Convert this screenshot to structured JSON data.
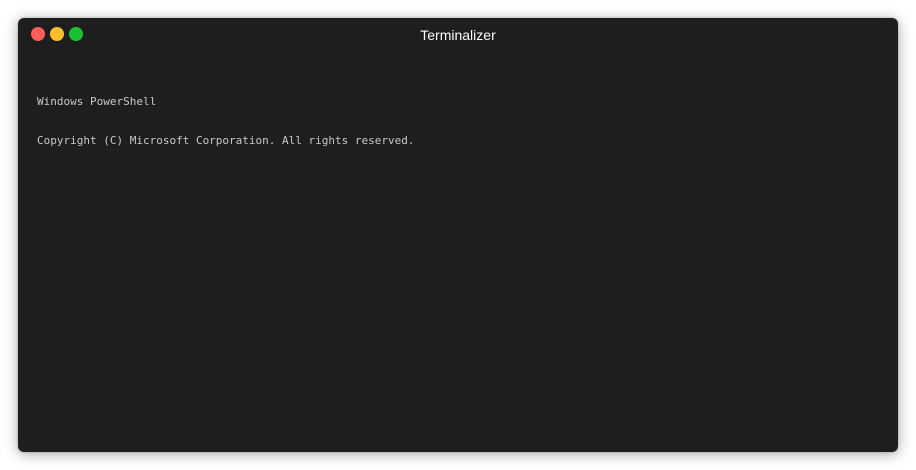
{
  "window": {
    "title": "Terminalizer"
  },
  "colors": {
    "background": "#1e1e1e",
    "close": "#ff5f58",
    "minimize": "#ffbd2e",
    "zoom": "#18c132",
    "text": "#c8c8c8"
  },
  "terminal": {
    "lines": [
      "Windows PowerShell",
      "Copyright (C) Microsoft Corporation. All rights reserved."
    ]
  }
}
